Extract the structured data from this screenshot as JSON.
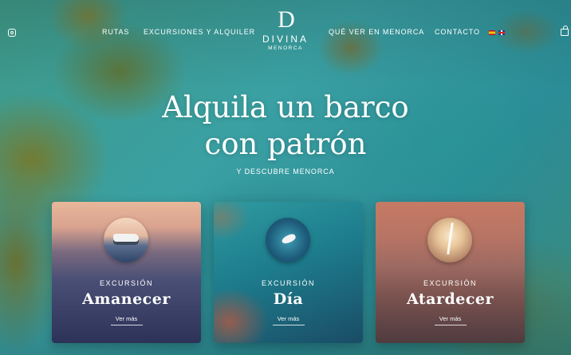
{
  "header": {
    "nav_left": [
      "RUTAS",
      "EXCURSIONES Y ALQUILER"
    ],
    "nav_right": [
      "QUÉ VER EN MENORCA",
      "CONTACTO"
    ],
    "logo": {
      "mark": "D",
      "name": "DIVINA",
      "sub": "MENORCA"
    },
    "languages": [
      "es-flag-icon",
      "en-flag-icon"
    ],
    "icons": [
      "instagram-icon",
      "cart-icon"
    ]
  },
  "hero": {
    "title_line1": "Alquila un barco",
    "title_line2": "con patrón",
    "subtitle": "Y DESCUBRE MENORCA"
  },
  "cards": [
    {
      "kicker": "EXCURSIÓN",
      "title": "Amanecer",
      "link": "Ver más"
    },
    {
      "kicker": "EXCURSIÓN",
      "title": "Día",
      "link": "Ver más"
    },
    {
      "kicker": "EXCURSIÓN",
      "title": "Atardecer",
      "link": "Ver más"
    }
  ],
  "colors": {
    "text": "#ffffff",
    "sea": "#2f8f92"
  }
}
